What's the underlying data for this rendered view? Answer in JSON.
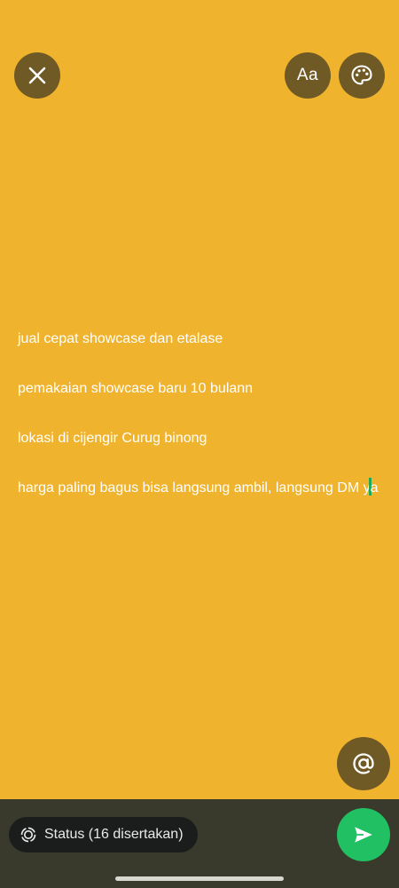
{
  "colors": {
    "background": "#f0b32d",
    "button": "#6f5a25",
    "bottom_bar": "#3a3a2c",
    "chip": "#1b1d1c",
    "send": "#21c063",
    "caret": "#1fa855"
  },
  "toolbar": {
    "close_icon": "close-icon",
    "font_label": "Aa",
    "palette_icon": "palette-icon"
  },
  "status": {
    "line1": "jual cepat showcase dan etalase",
    "line2": "pemakaian showcase baru 10 bulann",
    "line3": "lokasi di cijengir Curug binong",
    "line4": "harga paling bagus bisa langsung ambil, langsung DM y",
    "line4_after_caret": "a"
  },
  "mention_icon": "at-sign-icon",
  "footer": {
    "audience_label": "Status (16 disertakan)",
    "audience_icon": "status-ring-icon",
    "send_icon": "send-icon"
  }
}
